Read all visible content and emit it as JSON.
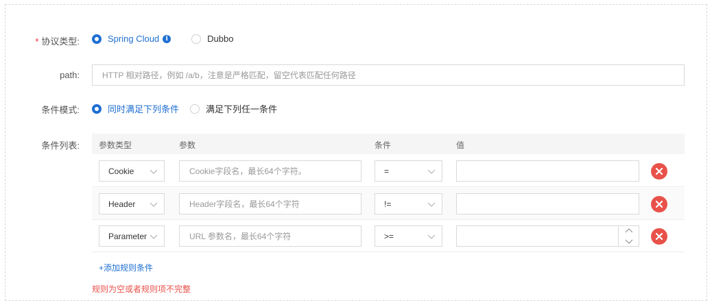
{
  "protocol": {
    "label": "协议类型:",
    "options": [
      {
        "label": "Spring Cloud",
        "checked": true
      },
      {
        "label": "Dubbo",
        "checked": false
      }
    ]
  },
  "path": {
    "label": "path:",
    "placeholder": "HTTP 相对路径，例如 /a/b，注意是严格匹配，留空代表匹配任何路径"
  },
  "mode": {
    "label": "条件模式:",
    "options": [
      {
        "label": "同时满足下列条件",
        "checked": true
      },
      {
        "label": "满足下列任一条件",
        "checked": false
      }
    ]
  },
  "conditions": {
    "label": "条件列表:",
    "columns": [
      "参数类型",
      "参数",
      "条件",
      "值"
    ],
    "rows": [
      {
        "type": "Cookie",
        "param_placeholder": "Cookie字段名，最长64个字符。",
        "op": "=",
        "value": ""
      },
      {
        "type": "Header",
        "param_placeholder": "Header字段名，最长64个字符",
        "op": "!=",
        "value": ""
      },
      {
        "type": "Parameter",
        "param_placeholder": "URL 参数名，最长64个字符",
        "op": ">=",
        "value": ""
      }
    ],
    "add_label": "+添加规则条件",
    "error": "规则为空或者规则项不完整"
  },
  "colors": {
    "accent": "#1f6fd2",
    "danger": "#e8524a"
  }
}
